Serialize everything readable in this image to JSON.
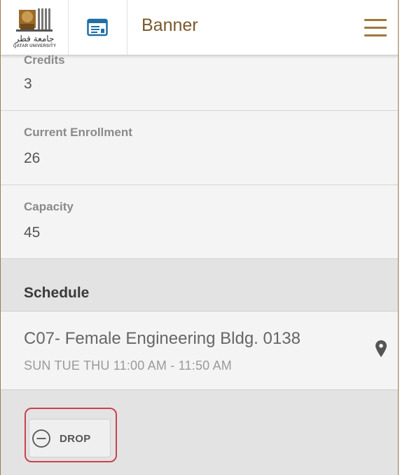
{
  "header": {
    "logo_arabic": "جامعة قطر",
    "logo_english": "QATAR UNIVERSITY",
    "app_icon": "id-card-icon",
    "title": "Banner",
    "menu_icon": "hamburger-menu-icon"
  },
  "fields": [
    {
      "label": "Credits",
      "value": "3"
    },
    {
      "label": "Current Enrollment",
      "value": "26"
    },
    {
      "label": "Capacity",
      "value": "45"
    }
  ],
  "schedule": {
    "heading": "Schedule",
    "location": "C07- Female Engineering Bldg. 0138",
    "time": "SUN TUE THU 11:00 AM - 11:50 AM",
    "pin_icon": "map-pin-icon"
  },
  "actions": {
    "drop_label": "DROP",
    "drop_icon": "minus-circle-icon"
  },
  "colors": {
    "brand": "#7a5a2c",
    "menu": "#a0773a",
    "highlight": "#c9434b",
    "app_icon": "#1f6fa5"
  }
}
